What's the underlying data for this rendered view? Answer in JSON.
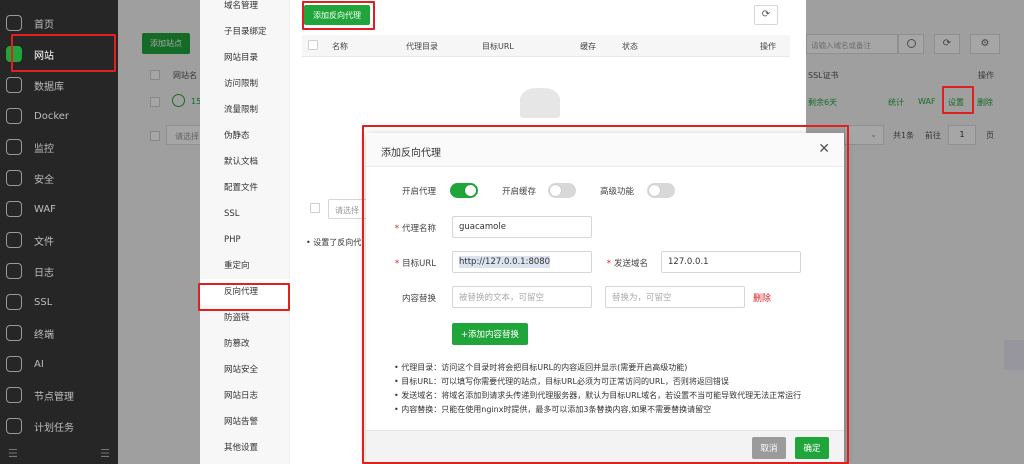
{
  "sidebar": {
    "items": [
      {
        "label": "首页",
        "icon": "home-icon"
      },
      {
        "label": "网站",
        "icon": "website-icon"
      },
      {
        "label": "数据库",
        "icon": "database-icon"
      },
      {
        "label": "Docker",
        "icon": "docker-icon"
      },
      {
        "label": "监控",
        "icon": "monitor-icon"
      },
      {
        "label": "安全",
        "icon": "shield-icon"
      },
      {
        "label": "WAF",
        "icon": "waf-icon"
      },
      {
        "label": "文件",
        "icon": "folder-icon"
      },
      {
        "label": "日志",
        "icon": "log-icon"
      },
      {
        "label": "SSL",
        "icon": "ssl-icon"
      },
      {
        "label": "终端",
        "icon": "terminal-icon"
      },
      {
        "label": "AI",
        "icon": "ai-icon"
      },
      {
        "label": "节点管理",
        "icon": "node-icon"
      },
      {
        "label": "计划任务",
        "icon": "schedule-icon"
      }
    ],
    "active_index": 1
  },
  "background": {
    "add_site": "添加站点",
    "site_name_col": "网站名",
    "search_placeholder": "请输入域名或备注",
    "ssl_col": "SSL证书",
    "action_col": "操作",
    "remaining": "剩余6天",
    "links": [
      "统计",
      "WAF",
      "设置",
      "删除"
    ],
    "select_placeholder": "请选择",
    "total": "共1条",
    "goto": "前往",
    "page": "1",
    "page_unit": "页",
    "row_number_prefix": "15"
  },
  "panel": {
    "subnav": [
      "域名管理",
      "子目录绑定",
      "网站目录",
      "访问限制",
      "流量限制",
      "伪静态",
      "默认文档",
      "配置文件",
      "SSL",
      "PHP",
      "重定向",
      "反向代理",
      "防盗链",
      "防篡改",
      "网站安全",
      "网站日志",
      "网站告警",
      "其他设置"
    ],
    "active_subnav": "反向代理",
    "add_proxy_button": "添加反向代理",
    "columns": [
      "名称",
      "代理目录",
      "目标URL",
      "缓存",
      "状态",
      "操作"
    ],
    "bottom_select_placeholder": "请选择",
    "bottom_note": "• 设置了反向代"
  },
  "modal": {
    "title": "添加反向代理",
    "enable_proxy_label": "开启代理",
    "enable_proxy": true,
    "enable_cache_label": "开启缓存",
    "enable_cache": false,
    "advanced_label": "高级功能",
    "advanced": false,
    "proxy_name_label": "代理名称",
    "proxy_name_value": "guacamole",
    "target_url_label": "目标URL",
    "target_url_value": "http://127.0.0.1:8080",
    "send_domain_label": "发送域名",
    "send_domain_value": "127.0.0.1",
    "content_replace_label": "内容替换",
    "replace_from_placeholder": "被替换的文本，可留空",
    "replace_to_placeholder": "替换为，可留空",
    "delete_label": "删除",
    "add_replace_button": "+添加内容替换",
    "notes": [
      "• 代理目录：访问这个目录时将会把目标URL的内容返回并显示(需要开启高级功能)",
      "• 目标URL：可以填写你需要代理的站点，目标URL必须为可正常访问的URL，否则将返回错误",
      "• 发送域名：将域名添加到请求头传递到代理服务器，默认为目标URL域名，若设置不当可能导致代理无法正常运行",
      "• 内容替换：只能在使用nginx时提供，最多可以添加3条替换内容,如果不需要替换请留空"
    ],
    "cancel_label": "取消",
    "confirm_label": "确定"
  },
  "colors": {
    "accent": "#20a53a",
    "danger": "#e02020",
    "sidebar_bg": "#262626"
  }
}
